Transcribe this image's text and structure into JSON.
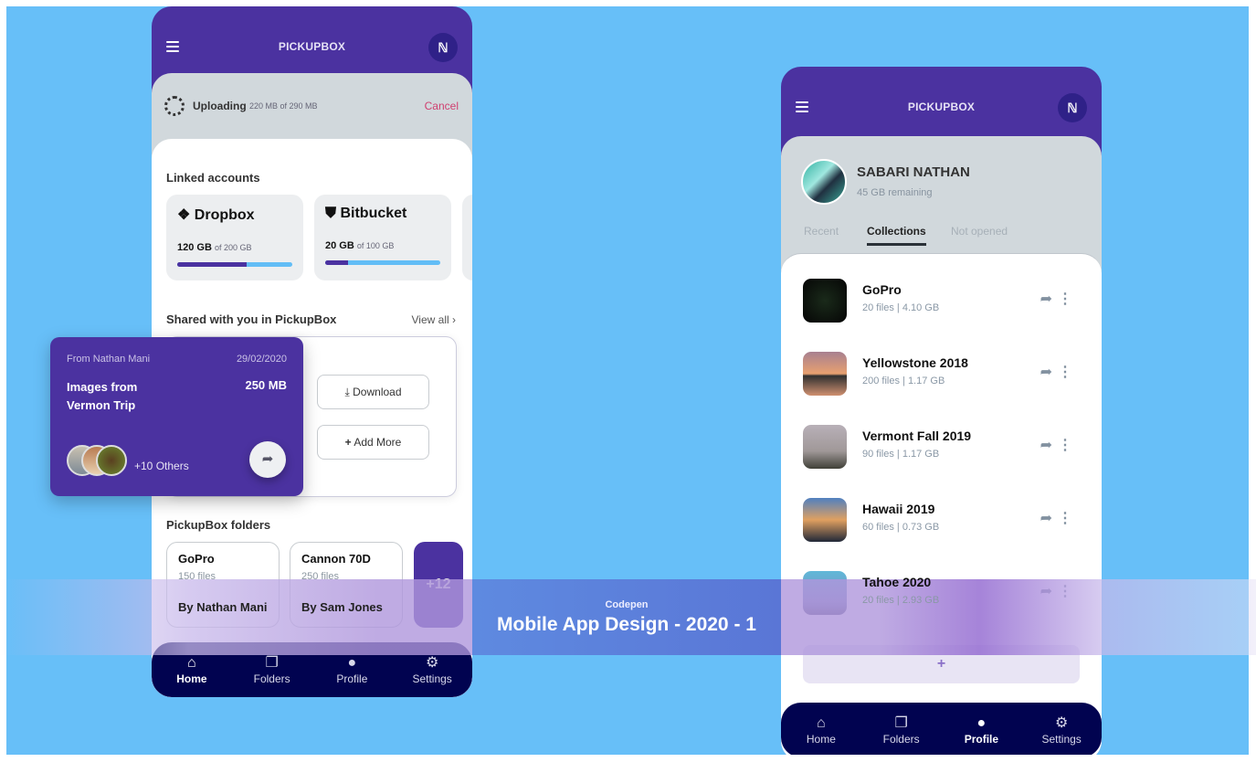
{
  "brand": "PICKUPBOX",
  "logo_text": "ℕ",
  "colors": {
    "primary": "#4b32a0",
    "nav": "#010350",
    "background": "#67bff8",
    "cancel": "#d04070"
  },
  "home": {
    "upload": {
      "label": "Uploading",
      "progress": "220 MB of 290 MB",
      "cancel": "Cancel"
    },
    "linked_title": "Linked accounts",
    "accounts": [
      {
        "name": "Dropbox",
        "icon": "dropbox-icon",
        "used": "120 GB",
        "total": "of 200 GB",
        "fraction": 0.6
      },
      {
        "name": "Bitbucket",
        "icon": "bitbucket-icon",
        "used": "20 GB",
        "total": "of 100 GB",
        "fraction": 0.2
      }
    ],
    "shared_title": "Shared with you in PickupBox",
    "view_all": "View all",
    "shared": {
      "from": "From Nathan Mani",
      "date": "29/02/2020",
      "title_line1": "Images from",
      "title_line2": "Vermon Trip",
      "size": "250 MB",
      "others": "+10 Others"
    },
    "download": "Download",
    "add_more": "Add More",
    "folders_title": "PickupBox folders",
    "folders": [
      {
        "name": "GoPro",
        "count": "150 files",
        "by": "By Nathan Mani"
      },
      {
        "name": "Cannon 70D",
        "count": "250 files",
        "by": "By Sam Jones"
      }
    ],
    "more_folders": "+12"
  },
  "nav": [
    "Home",
    "Folders",
    "Profile",
    "Settings"
  ],
  "profile": {
    "name": "SABARI NATHAN",
    "remaining": "45 GB remaining",
    "tabs": [
      "Recent",
      "Collections",
      "Not opened"
    ],
    "active_tab": "Collections",
    "collections": [
      {
        "name": "GoPro",
        "meta": "20  files | 4.10 GB"
      },
      {
        "name": "Yellowstone 2018",
        "meta": "200  files | 1.17 GB"
      },
      {
        "name": "Vermont Fall 2019",
        "meta": "90  files | 1.17 GB"
      },
      {
        "name": "Hawaii 2019",
        "meta": "60  files | 0.73 GB"
      },
      {
        "name": "Tahoe 2020",
        "meta": "20  files | 2.93 GB"
      }
    ],
    "add": "+"
  },
  "banner": {
    "sub": "Codepen",
    "title": "Mobile App Design - 2020 - 1"
  }
}
